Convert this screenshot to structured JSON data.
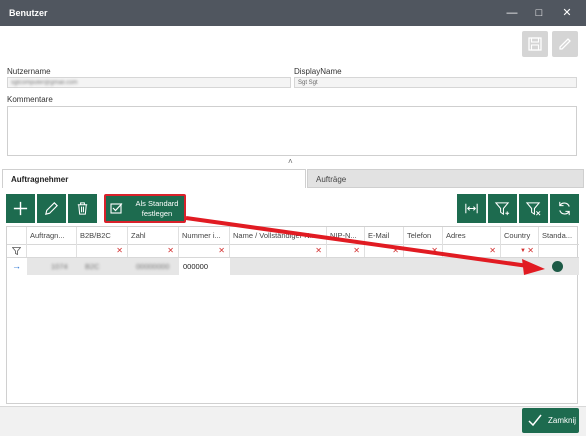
{
  "window": {
    "title": "Benutzer"
  },
  "fields": {
    "username_label": "Nutzername",
    "username_value": "sgtcomputer@gmail.com",
    "display_label": "DisplayName",
    "display_value": "Sgt Sgt",
    "comments_label": "Kommentare"
  },
  "tabs": [
    {
      "label": "Auftragnehmer"
    },
    {
      "label": "Aufträge"
    }
  ],
  "toolbar": {
    "set_default_label": "Als Standard festlegen"
  },
  "grid": {
    "columns": [
      "Auftragn...",
      "B2B/B2C",
      "Zahl",
      "Nummer i...",
      "Name / Vollständiger N...",
      "NIP-N...",
      "E-Mail",
      "Telefon",
      "Adres",
      "Country",
      "Standa..."
    ],
    "row": {
      "auftragnehmer": "1074",
      "b2b": "B2C",
      "zahl": "00000000",
      "nummer": "000000"
    }
  },
  "footer": {
    "close_label": "Zamknij"
  },
  "colors": {
    "accent": "#1d6b4f",
    "titlebar": "#50565f",
    "highlight": "#d9212b"
  }
}
